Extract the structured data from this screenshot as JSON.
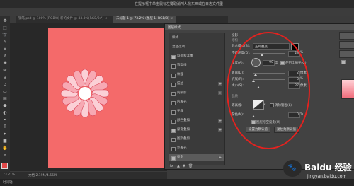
{
  "window": {
    "title": "在提示框中单击鼠标左键取消叫人找东西或在日志文件里"
  },
  "tabs": [
    {
      "label": "钢笔.psd @ 100% (RGB/8) 新的文件 @ 33.3%(RGB/8#) ×",
      "active": false
    },
    {
      "label": "未标题-1 @ 73.2% (图层 1, RGB/8) ×",
      "active": true
    }
  ],
  "tools": [
    "move",
    "marquee",
    "lasso",
    "quick-select",
    "crop",
    "eyedropper",
    "heal",
    "brush",
    "clone",
    "history",
    "eraser",
    "gradient",
    "blur",
    "dodge",
    "pen",
    "type",
    "path-select",
    "shape",
    "hand",
    "zoom"
  ],
  "status": {
    "zoom": "73.21%",
    "doc": "文档:2.19M/4.56M"
  },
  "timeline": {
    "label": "时间轴"
  },
  "dialog": {
    "title": "图层样式",
    "styles": [
      {
        "label": "样式",
        "checked": null,
        "plus": false,
        "selected": false
      },
      {
        "label": "混合选项",
        "checked": null,
        "plus": false,
        "selected": false
      },
      {
        "label": "斜面和浮雕",
        "checked": true,
        "plus": false,
        "selected": false
      },
      {
        "label": "等高线",
        "checked": false,
        "plus": false,
        "selected": false
      },
      {
        "label": "纹理",
        "checked": false,
        "plus": false,
        "selected": false
      },
      {
        "label": "描边",
        "checked": false,
        "plus": true,
        "selected": false
      },
      {
        "label": "内阴影",
        "checked": false,
        "plus": true,
        "selected": false
      },
      {
        "label": "内发光",
        "checked": false,
        "plus": false,
        "selected": false
      },
      {
        "label": "光泽",
        "checked": false,
        "plus": false,
        "selected": false
      },
      {
        "label": "颜色叠加",
        "checked": false,
        "plus": true,
        "selected": false
      },
      {
        "label": "渐变叠加",
        "checked": true,
        "plus": true,
        "selected": false
      },
      {
        "label": "图案叠加",
        "checked": false,
        "plus": false,
        "selected": false
      },
      {
        "label": "外发光",
        "checked": false,
        "plus": false,
        "selected": false
      },
      {
        "label": "投影",
        "checked": true,
        "plus": true,
        "selected": true
      }
    ],
    "footer_icons": [
      "fx",
      "up",
      "down",
      "trash"
    ],
    "panel": {
      "section": "投影",
      "struct": "结构",
      "blend_label": "混合模式(B):",
      "blend_value": "正片叠底",
      "opacity_label": "不透明度(O):",
      "opacity": "28",
      "angle_label": "角度(A):",
      "angle": "90",
      "angle_unit": "度",
      "global_light": "使用全局光(G)",
      "distance_label": "距离(D):",
      "distance": "2",
      "spread_label": "扩展(R):",
      "spread": "0",
      "size_label": "大小(S):",
      "size": "27",
      "quality": "品质",
      "contour_label": "等高线:",
      "antialias": "消除锯齿(L)",
      "noise_label": "杂色(N):",
      "noise": "0",
      "knockout": "图层挖空投影(U)",
      "default_btn": "设置为默认值",
      "reset_btn": "复位为默认值",
      "px": "像素",
      "pct": "%"
    }
  },
  "watermark": {
    "text": "Baidu 经验",
    "url": "jingyan.baidu.com"
  },
  "chart_data": null
}
